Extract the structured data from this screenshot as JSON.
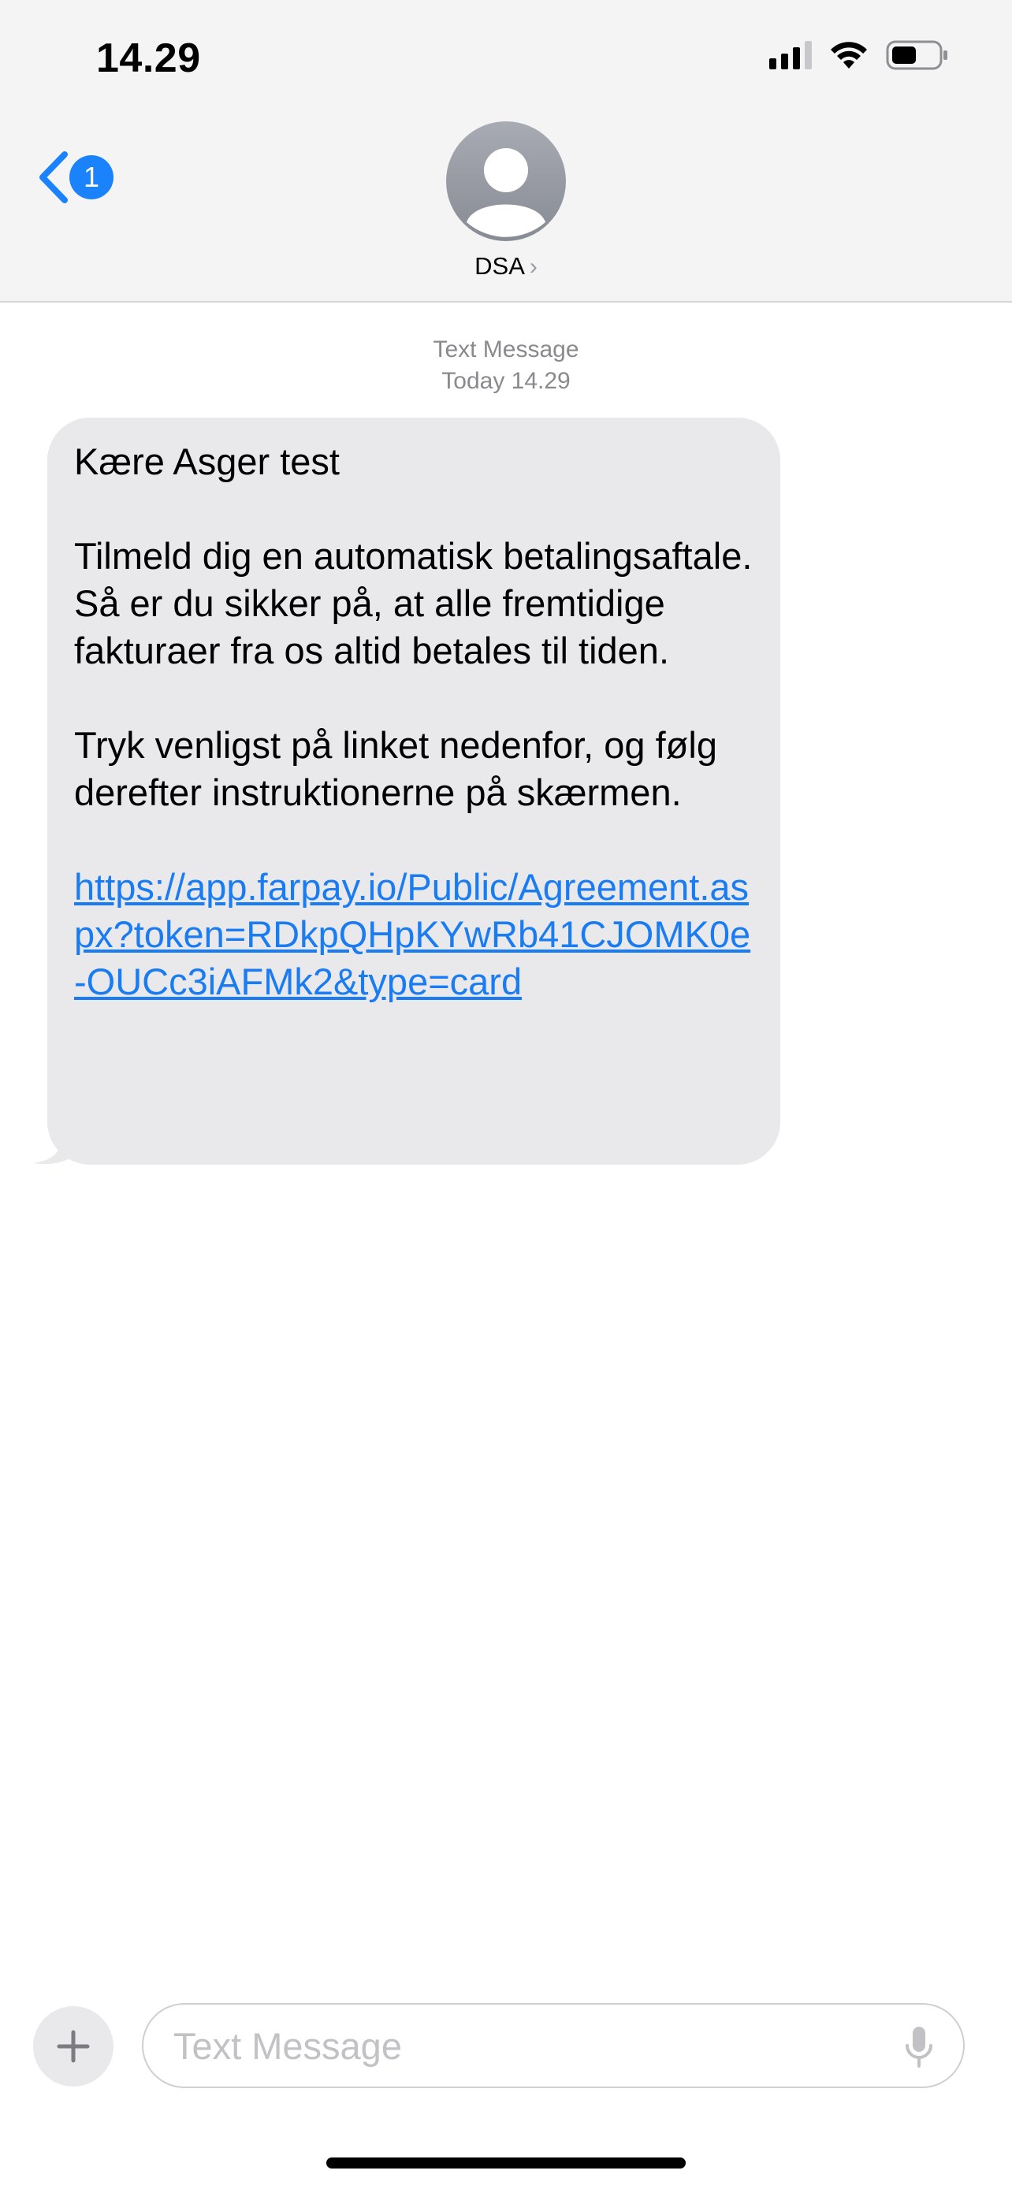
{
  "status_bar": {
    "time": "14.29",
    "icons": [
      "cellular-signal-icon",
      "wifi-icon",
      "battery-icon"
    ]
  },
  "nav": {
    "back_badge_count": "1",
    "contact_name": "DSA",
    "contact_chevron": "›"
  },
  "thread": {
    "service_label": "Text Message",
    "timestamp": "Today 14.29",
    "message": {
      "greeting": "Kære Asger test",
      "paragraph_1": "Tilmeld dig en automatisk betalingsaftale. Så er du sikker på, at alle fremtidige fakturaer fra os altid betales til tiden.",
      "paragraph_2": "Tryk venligst på linket nedenfor, og følg derefter instruktionerne på skærmen.",
      "link": "https://app.farpay.io/Public/Agreement.aspx?token=RDkpQHpKYwRb41CJOMK0e-OUCc3iAFMk2&type=card"
    }
  },
  "composer": {
    "placeholder": "Text Message"
  },
  "colors": {
    "accent": "#1a82fb",
    "bubble": "#e9e9eb",
    "link": "#1a7cf2",
    "header_bg": "#f4f4f5"
  }
}
